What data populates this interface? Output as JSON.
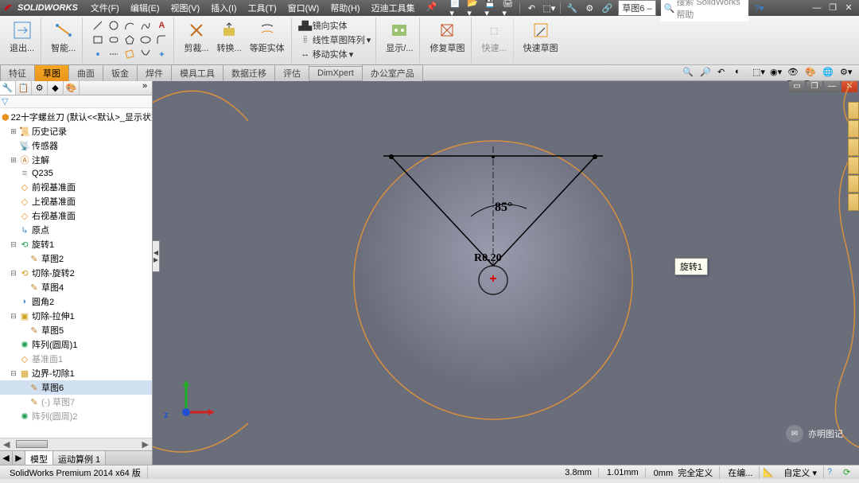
{
  "app": {
    "name": "SOLIDWORKS"
  },
  "menu": {
    "file": "文件(F)",
    "edit": "编辑(E)",
    "view": "视图(V)",
    "insert": "插入(I)",
    "tools": "工具(T)",
    "window": "窗口(W)",
    "help": "帮助(H)",
    "maidi": "迈迪工具集"
  },
  "qat": {
    "doc_name": "草图6 –",
    "search_placeholder": "搜索 SolidWorks 帮助"
  },
  "toolbar": {
    "exit": "退出...",
    "smart": "智能...",
    "trim": "剪裁...",
    "convert": "转换...",
    "offset": "等距实体",
    "mirror": "镜向实体",
    "pattern": "线性草图阵列",
    "move": "移动实体",
    "display": "显示/...",
    "repair": "修复草图",
    "quick": "快速...",
    "quick_sketch": "快速草图"
  },
  "ribbon": {
    "tabs": [
      "特征",
      "草图",
      "曲面",
      "钣金",
      "焊件",
      "模具工具",
      "数据迁移",
      "评估",
      "DimXpert",
      "办公室产品"
    ],
    "active": 1
  },
  "tree": {
    "root": "22十字螺丝刀  (默认<<默认>_显示状态",
    "items": [
      {
        "icon": "history",
        "label": "历史记录",
        "indent": 1,
        "exp": "+"
      },
      {
        "icon": "sensor",
        "label": "传感器",
        "indent": 1,
        "exp": ""
      },
      {
        "icon": "annot",
        "label": "注解",
        "indent": 1,
        "exp": "+"
      },
      {
        "icon": "material",
        "label": "Q235",
        "indent": 1,
        "exp": ""
      },
      {
        "icon": "plane",
        "label": "前视基准面",
        "indent": 1,
        "exp": ""
      },
      {
        "icon": "plane",
        "label": "上视基准面",
        "indent": 1,
        "exp": ""
      },
      {
        "icon": "plane",
        "label": "右视基准面",
        "indent": 1,
        "exp": ""
      },
      {
        "icon": "origin",
        "label": "原点",
        "indent": 1,
        "exp": ""
      },
      {
        "icon": "revolve",
        "label": "旋转1",
        "indent": 1,
        "exp": "-"
      },
      {
        "icon": "sketch",
        "label": "草图2",
        "indent": 2,
        "exp": ""
      },
      {
        "icon": "cut-rev",
        "label": "切除-旋转2",
        "indent": 1,
        "exp": "-"
      },
      {
        "icon": "sketch",
        "label": "草图4",
        "indent": 2,
        "exp": ""
      },
      {
        "icon": "fillet",
        "label": "圆角2",
        "indent": 1,
        "exp": ""
      },
      {
        "icon": "cut-ext",
        "label": "切除-拉伸1",
        "indent": 1,
        "exp": "-"
      },
      {
        "icon": "sketch",
        "label": "草图5",
        "indent": 2,
        "exp": ""
      },
      {
        "icon": "circ-pat",
        "label": "阵列(圆周)1",
        "indent": 1,
        "exp": ""
      },
      {
        "icon": "plane",
        "label": "基准面1",
        "indent": 1,
        "exp": "",
        "dim": true
      },
      {
        "icon": "cut-bnd",
        "label": "边界-切除1",
        "indent": 1,
        "exp": "-"
      },
      {
        "icon": "sketch",
        "label": "草图6",
        "indent": 2,
        "exp": "",
        "sel": true
      },
      {
        "icon": "sketch",
        "label": "(-) 草图7",
        "indent": 2,
        "exp": "",
        "dim": true
      },
      {
        "icon": "circ-pat",
        "label": "阵列(圆周)2",
        "indent": 1,
        "exp": "",
        "dim": true
      }
    ]
  },
  "view_tabs": {
    "model": "模型",
    "motion": "运动算例 1"
  },
  "sketch": {
    "angle_label": "85°",
    "radius_label": "R0.20",
    "callout": "旋转1",
    "triad_z": "z"
  },
  "status": {
    "product": "SolidWorks Premium 2014 x64 版",
    "len": "3.8mm",
    "dim2": "1.01mm",
    "dim3": "0mm",
    "def": "完全定义",
    "edit": "在编...",
    "custom": "自定义"
  },
  "watermark": "亦明图记"
}
